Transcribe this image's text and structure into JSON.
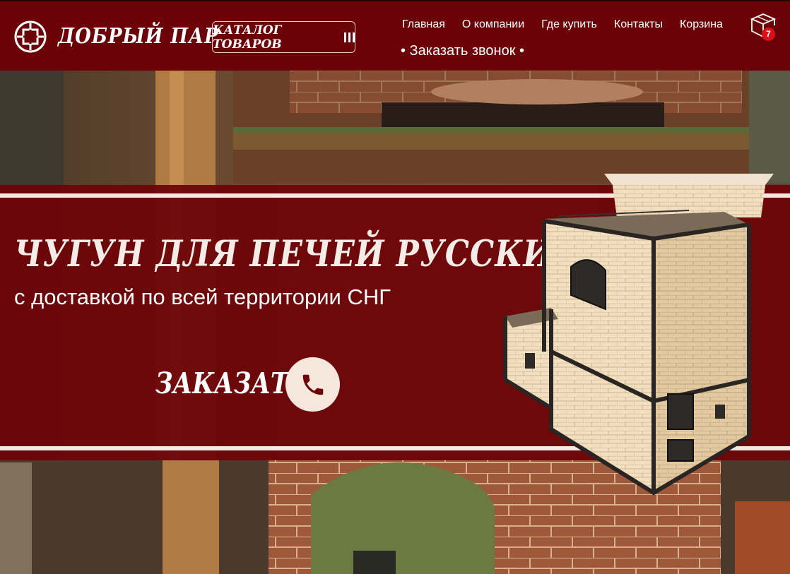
{
  "header": {
    "logo_text": "ДОБРЫЙ ПАР",
    "catalog_label": "КАТАЛОГ ТОВАРОВ",
    "nav": [
      {
        "label": "Главная"
      },
      {
        "label": "О компании"
      },
      {
        "label": "Где купить"
      },
      {
        "label": "Контакты"
      },
      {
        "label": "Корзина"
      }
    ],
    "cart_count": "7",
    "callback_label": "• Заказать звонок •"
  },
  "hero": {
    "title": "ЧУГУН ДЛЯ ПЕЧЕЙ РУССКИХ БАНЬ",
    "subtitle": "с доставкой по всей территории СНГ",
    "order_label": "ЗАКАЗАТЬ"
  },
  "icons": {
    "logo": "logo-knot-icon",
    "cart": "box-cart-icon",
    "call": "phone-icon"
  },
  "colors": {
    "header_bg": "#6b0208",
    "band_bg": "#6e0408",
    "band_line": "#f4e9e1",
    "badge": "#d8101a"
  }
}
